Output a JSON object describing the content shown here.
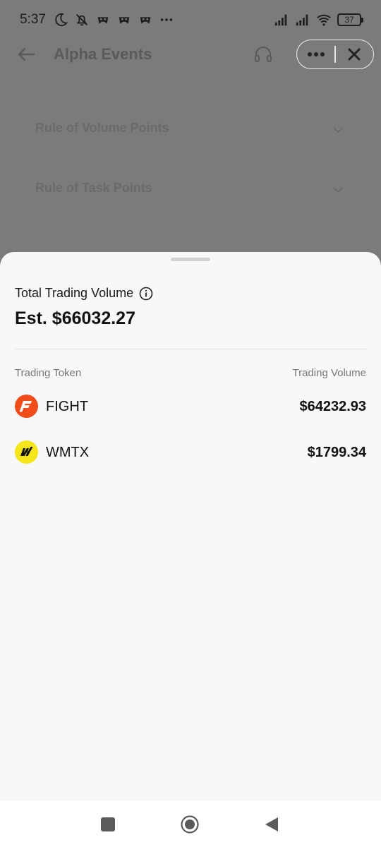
{
  "status_bar": {
    "time": "5:37",
    "battery": "37",
    "icons": [
      "moon-icon",
      "bell-off-icon",
      "game-icon",
      "game-icon",
      "game-icon",
      "more-dots-icon",
      "signal-icon",
      "signal-icon",
      "wifi-icon",
      "battery-icon"
    ]
  },
  "header": {
    "title": "Alpha Events",
    "icons": [
      "back-arrow-icon",
      "headset-icon",
      "more-horizontal-icon",
      "close-icon"
    ]
  },
  "rules": [
    {
      "label": "Rule of Volume Points"
    },
    {
      "label": "Rule of Task Points"
    }
  ],
  "sheet": {
    "total_label": "Total Trading Volume",
    "total_value": "Est. $66032.27",
    "col_token": "Trading Token",
    "col_volume": "Trading Volume",
    "tokens": [
      {
        "name": "FIGHT",
        "volume": "$64232.93",
        "icon": "fight-token-icon",
        "color": "#f04d1a"
      },
      {
        "name": "WMTX",
        "volume": "$1799.34",
        "icon": "wmtx-token-icon",
        "color": "#f5e51a"
      }
    ]
  },
  "nav_bar": {
    "icons": [
      "recents-square-icon",
      "home-circle-icon",
      "back-triangle-icon"
    ]
  }
}
